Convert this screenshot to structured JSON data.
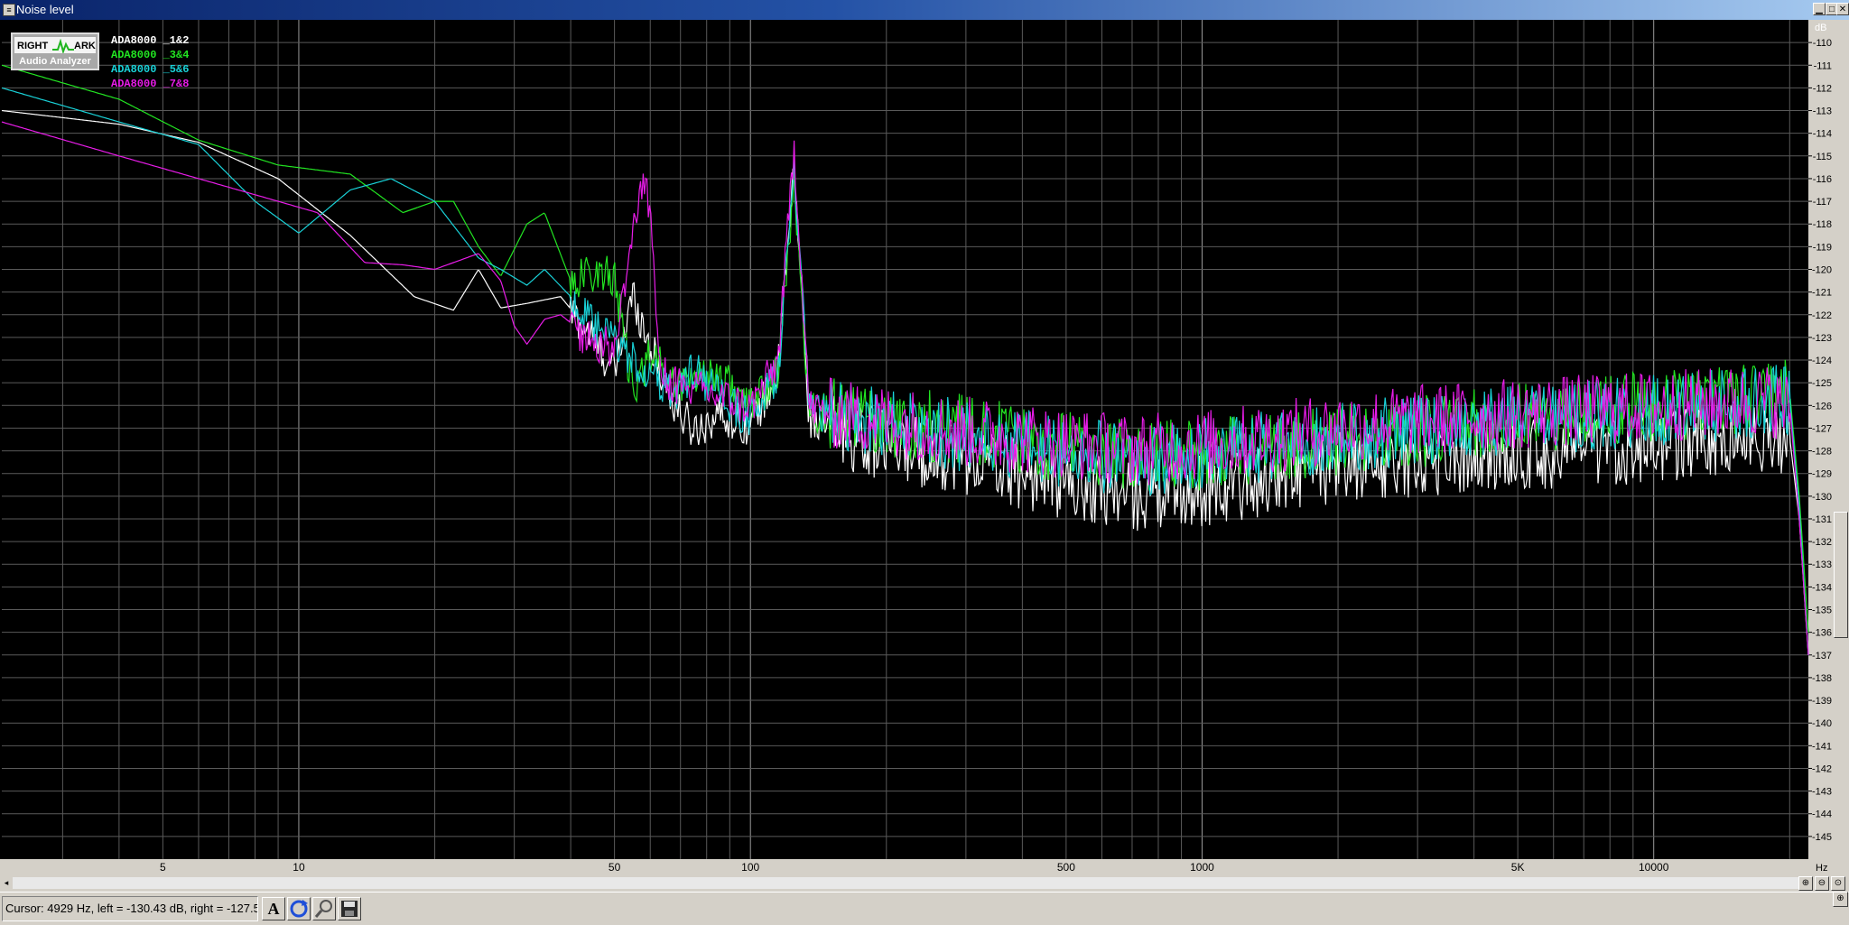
{
  "window": {
    "title": "Noise level",
    "buttons": [
      "▁",
      "□",
      "✕"
    ]
  },
  "logo": {
    "word1": "RIGHT",
    "word2": "ARK",
    "subtitle": "Audio Analyzer"
  },
  "status": {
    "cursor_text": "Cursor:  4929 Hz,  left = -130.43 dB,  right = -127.5"
  },
  "icons": [
    "font-icon",
    "refresh-icon",
    "zoom-tool-icon",
    "save-icon",
    "zoom-in-icon",
    "zoom-out-icon",
    "zoom-reset-icon",
    "zoom-corner-icon"
  ],
  "chart_data": {
    "type": "line",
    "y_unit_label": "dB",
    "x_unit_label": "Hz",
    "x_scale": "log",
    "xlim": [
      2.2,
      22000
    ],
    "ylim": [
      -146,
      -109
    ],
    "grid": true,
    "legend_placement": "top-left",
    "x_tick_labels": [
      {
        "value": 5,
        "label": "5"
      },
      {
        "value": 10,
        "label": "10"
      },
      {
        "value": 50,
        "label": "50"
      },
      {
        "value": 100,
        "label": "100"
      },
      {
        "value": 500,
        "label": "500"
      },
      {
        "value": 1000,
        "label": "1000"
      },
      {
        "value": 5000,
        "label": "5K"
      },
      {
        "value": 10000,
        "label": "10000"
      }
    ],
    "y_ticks": [
      -110,
      -111,
      -112,
      -113,
      -114,
      -115,
      -116,
      -117,
      -118,
      -119,
      -120,
      -121,
      -122,
      -123,
      -124,
      -125,
      -126,
      -127,
      -128,
      -129,
      -130,
      -131,
      -132,
      -133,
      -134,
      -135,
      -136,
      -137,
      -138,
      -139,
      -140,
      -141,
      -142,
      -143,
      -144,
      -145
    ],
    "series": [
      {
        "name": "ADA8000 _1&2",
        "color": "#ffffff",
        "x": [
          2.2,
          4,
          6,
          9,
          13,
          18,
          22,
          25,
          28,
          32,
          38,
          45,
          50,
          55,
          58,
          62,
          68,
          75,
          85,
          100,
          115,
          125,
          135,
          150,
          200,
          300,
          500,
          700,
          1000,
          1500,
          2000,
          3000,
          5000,
          8000,
          12000,
          18000,
          20000,
          21000,
          22000
        ],
        "y": [
          -113,
          -113.6,
          -114.4,
          -116,
          -118.5,
          -121.2,
          -121.8,
          -120,
          -121.7,
          -121.5,
          -121.2,
          -123,
          -124.5,
          -121,
          -122.5,
          -124,
          -126,
          -127,
          -126.3,
          -126.8,
          -124.5,
          -115.5,
          -126.5,
          -126.9,
          -127.6,
          -128.2,
          -129.3,
          -129.8,
          -129.6,
          -129,
          -128.6,
          -128.3,
          -128,
          -127.8,
          -127.5,
          -127.2,
          -127.4,
          -131,
          -137
        ]
      },
      {
        "name": "ADA8000 _3&4",
        "color": "#22e522",
        "x": [
          2.2,
          4,
          6,
          9,
          13,
          17,
          20,
          22,
          25,
          28,
          32,
          35,
          40,
          45,
          50,
          55,
          60,
          68,
          75,
          85,
          100,
          115,
          125,
          135,
          150,
          200,
          300,
          500,
          700,
          1000,
          1500,
          2000,
          3000,
          5000,
          8000,
          12000,
          18000,
          20000,
          21000,
          22000
        ],
        "y": [
          -111,
          -112.5,
          -114.3,
          -115.4,
          -115.8,
          -117.5,
          -117,
          -117,
          -119,
          -120.3,
          -118,
          -117.5,
          -120.5,
          -120,
          -120.3,
          -125.5,
          -123.5,
          -125,
          -124.5,
          -124.5,
          -126,
          -124.5,
          -116,
          -126.2,
          -126.2,
          -126.6,
          -126.9,
          -127.7,
          -128.1,
          -128,
          -127.6,
          -127.4,
          -127,
          -126.4,
          -126,
          -125.8,
          -125.3,
          -125.4,
          -130,
          -136
        ]
      },
      {
        "name": "ADA8000 _5&6",
        "color": "#19d2d8",
        "x": [
          2.2,
          4,
          6,
          8,
          10,
          13,
          16,
          20,
          25,
          28,
          32,
          35,
          40,
          45,
          50,
          55,
          60,
          68,
          75,
          85,
          100,
          115,
          125,
          135,
          150,
          200,
          300,
          500,
          700,
          1000,
          1500,
          2000,
          3000,
          5000,
          8000,
          12000,
          18000,
          20000,
          21000,
          22000
        ],
        "y": [
          -112,
          -113.5,
          -114.5,
          -117,
          -118.4,
          -116.5,
          -116,
          -117,
          -119.5,
          -120,
          -120.7,
          -120,
          -121.2,
          -122.5,
          -123,
          -124,
          -124.5,
          -125.5,
          -124.3,
          -125.5,
          -126.5,
          -124.5,
          -115.5,
          -126.2,
          -126.2,
          -126.6,
          -127.2,
          -127.9,
          -128.3,
          -128,
          -127.6,
          -127.3,
          -126.9,
          -126.5,
          -126.2,
          -126,
          -125.6,
          -125.7,
          -130.5,
          -137
        ]
      },
      {
        "name": "ADA8000 _7&8",
        "color": "#e81ce8",
        "x": [
          2.2,
          4,
          6,
          9,
          11,
          14,
          17,
          20,
          25,
          28,
          30,
          32,
          35,
          38,
          42,
          45,
          50,
          55,
          57,
          60,
          63,
          68,
          75,
          85,
          100,
          115,
          125,
          135,
          150,
          200,
          300,
          500,
          700,
          1000,
          1500,
          2000,
          3000,
          5000,
          8000,
          12000,
          18000,
          20000,
          21000,
          22000
        ],
        "y": [
          -113.5,
          -115,
          -116,
          -117,
          -117.5,
          -119.7,
          -119.8,
          -120,
          -119.3,
          -120.5,
          -122.5,
          -123.3,
          -122.2,
          -122,
          -122.7,
          -123,
          -123.5,
          -118,
          -116.2,
          -117,
          -124.5,
          -125,
          -125.2,
          -125.5,
          -126,
          -124,
          -114.5,
          -126,
          -126.2,
          -126.5,
          -127,
          -127.5,
          -127.8,
          -127.6,
          -127.2,
          -126.8,
          -126.5,
          -126.2,
          -126,
          -125.8,
          -125.6,
          -126,
          -131,
          -137
        ]
      }
    ]
  }
}
